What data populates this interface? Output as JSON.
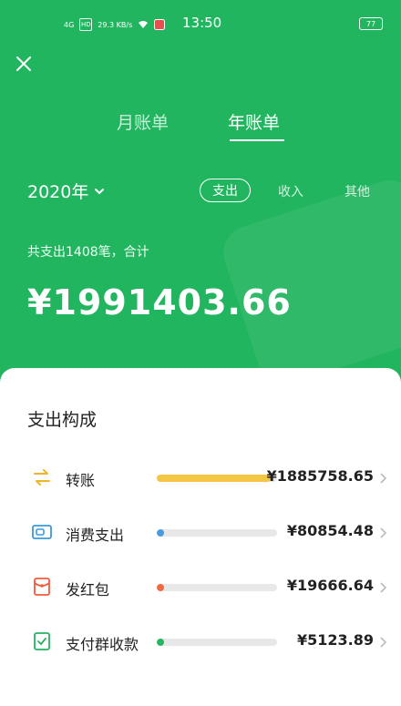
{
  "status_bar": {
    "network": "4G",
    "hd": "HD",
    "speed": "29.3 KB/s",
    "time": "13:50",
    "battery": "77"
  },
  "tabs": [
    {
      "label": "月账单",
      "active": false
    },
    {
      "label": "年账单",
      "active": true
    }
  ],
  "year_selector": {
    "value": "2020年"
  },
  "filters": [
    {
      "label": "支出",
      "active": true
    },
    {
      "label": "收入",
      "active": false
    },
    {
      "label": "其他",
      "active": false
    }
  ],
  "summary": {
    "text": "共支出1408笔，合计",
    "total": "¥1991403.66"
  },
  "breakdown": {
    "title": "支出构成",
    "items": [
      {
        "label": "转账",
        "amount": "¥1885758.65",
        "share": 0.9469,
        "color": "#f5c544",
        "icon": "transfer-icon"
      },
      {
        "label": "消费支出",
        "amount": "¥80854.48",
        "share": 0.0406,
        "color": "#4a9be0",
        "icon": "wallet-icon"
      },
      {
        "label": "发红包",
        "amount": "¥19666.64",
        "share": 0.0099,
        "color": "#f26a3d",
        "icon": "red-packet-icon"
      },
      {
        "label": "支付群收款",
        "amount": "¥5123.89",
        "share": 0.0026,
        "color": "#26b562",
        "icon": "group-payment-icon"
      }
    ]
  },
  "colors": {
    "brand_green": "#22b55f"
  }
}
